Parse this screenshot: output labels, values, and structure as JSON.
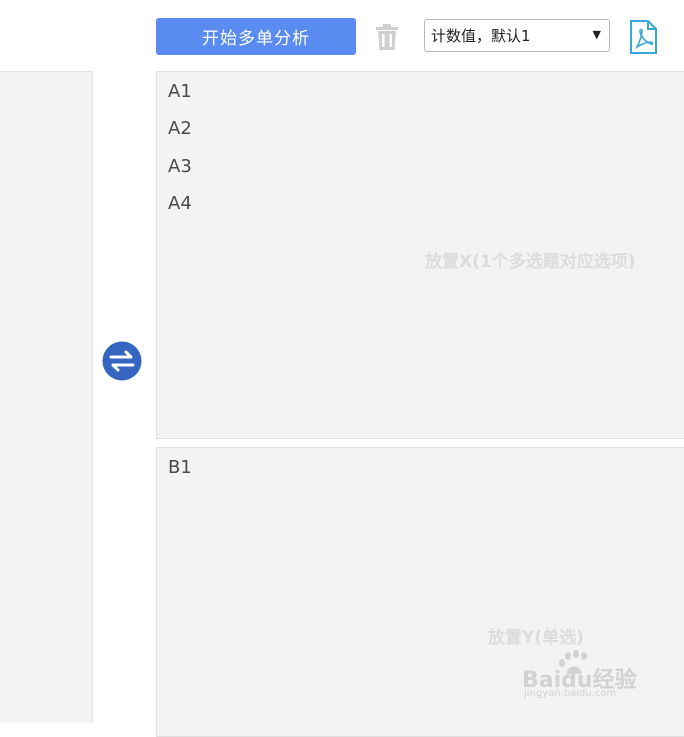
{
  "toolbar": {
    "analyze_label": "开始多单分析",
    "select_value": "计数值，默认1",
    "delete_icon": "trash-icon",
    "export_icon": "pdf-icon"
  },
  "swap_icon": "swap-arrows-icon",
  "zone_x": {
    "items": [
      "A1",
      "A2",
      "A3",
      "A4"
    ],
    "hint": "放置X(1个多选题对应选项)"
  },
  "zone_y": {
    "items": [
      "B1"
    ],
    "hint": "放置Y(单选)"
  },
  "watermark": {
    "brand": "Baidu经验",
    "url": "jingyan.baidu.com"
  },
  "colors": {
    "primary": "#5a8bf0",
    "swap": "#3565c1",
    "pdf": "#3aa7d9",
    "zone_bg": "#f3f3f3"
  }
}
